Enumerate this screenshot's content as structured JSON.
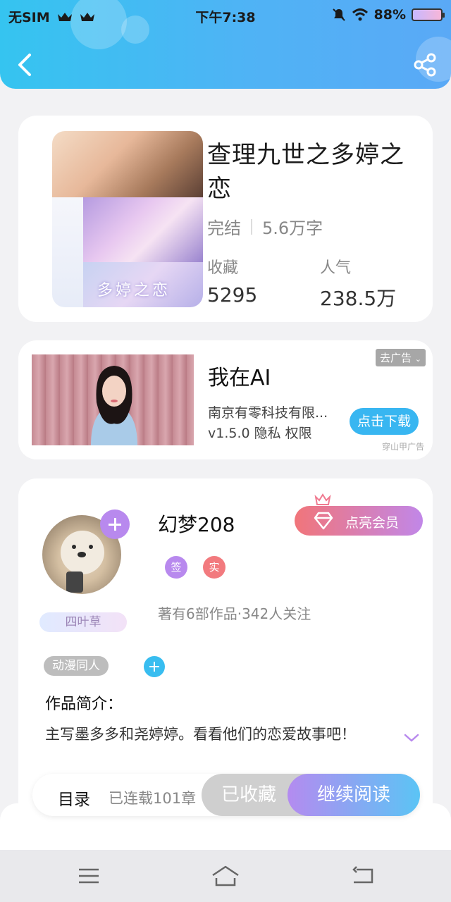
{
  "status_bar": {
    "carrier": "无SIM",
    "time": "下午7:38",
    "battery": "88%"
  },
  "header": {
    "back_icon": "back-arrow-icon",
    "share_icon": "share-icon",
    "accent": "#4fb3f5"
  },
  "book": {
    "title": "查理九世之多婷之恋",
    "cover_title": "多婷之恋",
    "status": "完结",
    "word_count": "5.6万字",
    "stats": {
      "favorites_label": "收藏",
      "favorites_value": "5295",
      "popularity_label": "人气",
      "popularity_value": "238.5万"
    }
  },
  "ad": {
    "dismiss_label": "去广告",
    "title": "我在AI",
    "company": "南京有零科技有限...",
    "version": "v1.5.0  隐私  权限",
    "download_label": "点击下载",
    "source": "穿山甲广告"
  },
  "author": {
    "name": "幻梦208",
    "vip_label": "点亮会员",
    "badge_sign": "签",
    "badge_real": "实",
    "level": "四叶草",
    "stats": "著有6部作品·342人关注",
    "genre_tag": "动漫同人",
    "intro_label": "作品简介：",
    "intro_text": "主写墨多多和尧婷婷。看看他们的恋爱故事吧！"
  },
  "action_bar": {
    "toc_label": "目录",
    "chapter_count": "已连载101章",
    "collected_label": "已收藏",
    "read_label": "继续阅读"
  },
  "nav_bar": {
    "menu_icon": "menu-icon",
    "home_icon": "home-icon",
    "back_icon": "back-icon"
  }
}
